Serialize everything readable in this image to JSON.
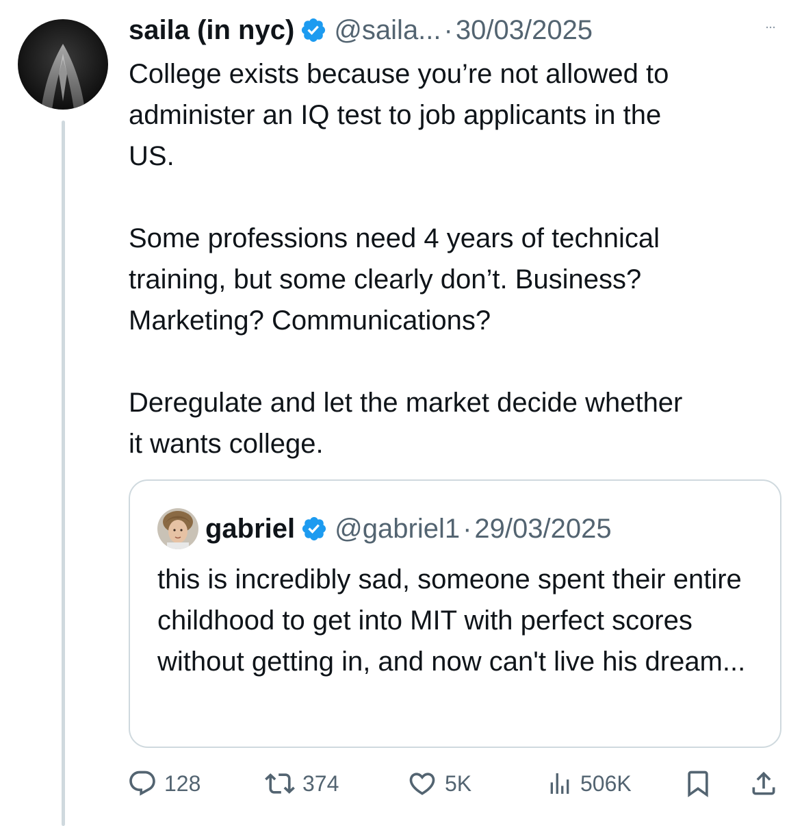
{
  "tweet": {
    "author_name": "saila (in nyc)",
    "handle": "@saila...",
    "separator": "·",
    "date": "30/03/2025",
    "text": "College exists because you’re not allowed to\nadminister an IQ test to job applicants in the\nUS.\n\nSome professions need 4 years of technical\ntraining, but some clearly don’t. Business?\nMarketing? Communications?\n\nDeregulate and let the market decide whether\nit wants college."
  },
  "quoted": {
    "author_name": "gabriel",
    "handle": "@gabriel1",
    "separator": "·",
    "date": "29/03/2025",
    "text": "this is incredibly sad, someone spent their entire childhood to get into MIT with perfect scores without getting in, and now can't live his dream..."
  },
  "actions": {
    "replies": "128",
    "reposts": "374",
    "likes": "5K",
    "views": "506K"
  },
  "colors": {
    "text": "#0f1419",
    "muted": "#536471",
    "verified": "#1d9bf0",
    "border": "#cfd9de"
  },
  "icons": {
    "reply": "reply-icon",
    "repost": "repost-icon",
    "like": "heart-icon",
    "views": "views-icon",
    "bookmark": "bookmark-icon",
    "share": "share-icon",
    "verified": "verified-badge-icon",
    "more": "more-icon"
  }
}
